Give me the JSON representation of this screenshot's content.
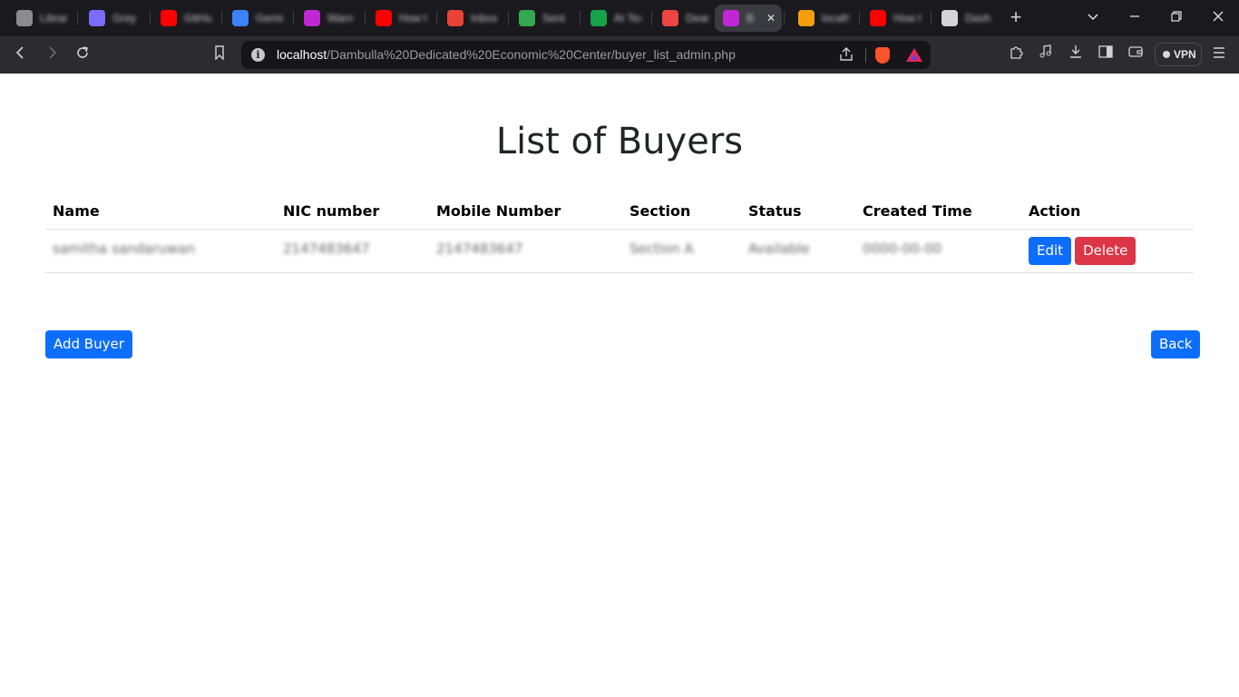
{
  "browser": {
    "tabs": [
      {
        "title": "Librar",
        "favicon": "github-icon",
        "color": "#8b8b90"
      },
      {
        "title": "Grey",
        "favicon": "extension-icon",
        "color": "#7a6cff"
      },
      {
        "title": "GitHub",
        "favicon": "youtube-icon",
        "color": "#ff0000"
      },
      {
        "title": "Gemini",
        "favicon": "gemini-icon",
        "color": "#3b82f6"
      },
      {
        "title": "Warn",
        "favicon": "app-icon",
        "color": "#c026d3"
      },
      {
        "title": "How t",
        "favicon": "youtube-icon",
        "color": "#ff0000"
      },
      {
        "title": "Inbox",
        "favicon": "gmail-icon",
        "color": "#ea4335"
      },
      {
        "title": "Sent",
        "favicon": "gmail-icon",
        "color": "#34a853"
      },
      {
        "title": "AI Tex",
        "favicon": "ai-icon",
        "color": "#16a34a"
      },
      {
        "title": "Dear",
        "favicon": "doc-icon",
        "color": "#ef4444"
      },
      {
        "title": "B",
        "favicon": "app-icon",
        "color": "#c026d3",
        "active": true
      },
      {
        "title": "localh",
        "favicon": "xampp-icon",
        "color": "#f59e0b"
      },
      {
        "title": "How t",
        "favicon": "youtube-icon",
        "color": "#ff0000"
      },
      {
        "title": "Dash",
        "favicon": "page-icon",
        "color": "#d4d4d8"
      }
    ],
    "url_host": "localhost",
    "url_path": "/Dambulla%20Dedicated%20Economic%20Center/buyer_list_admin.php",
    "vpn_label": "VPN"
  },
  "page": {
    "title": "List of Buyers",
    "columns": [
      "Name",
      "NIC number",
      "Mobile Number",
      "Section",
      "Status",
      "Created Time",
      "Action"
    ],
    "rows": [
      {
        "name": "samitha sandaruwan",
        "nic": "2147483647",
        "mobile": "2147483647",
        "section": "Section A",
        "status": "Available",
        "created": "0000-00-00",
        "edit_label": "Edit",
        "delete_label": "Delete"
      }
    ],
    "add_label": "Add Buyer",
    "back_label": "Back"
  },
  "colors": {
    "primary": "#0d6efd",
    "danger": "#dc3545"
  }
}
